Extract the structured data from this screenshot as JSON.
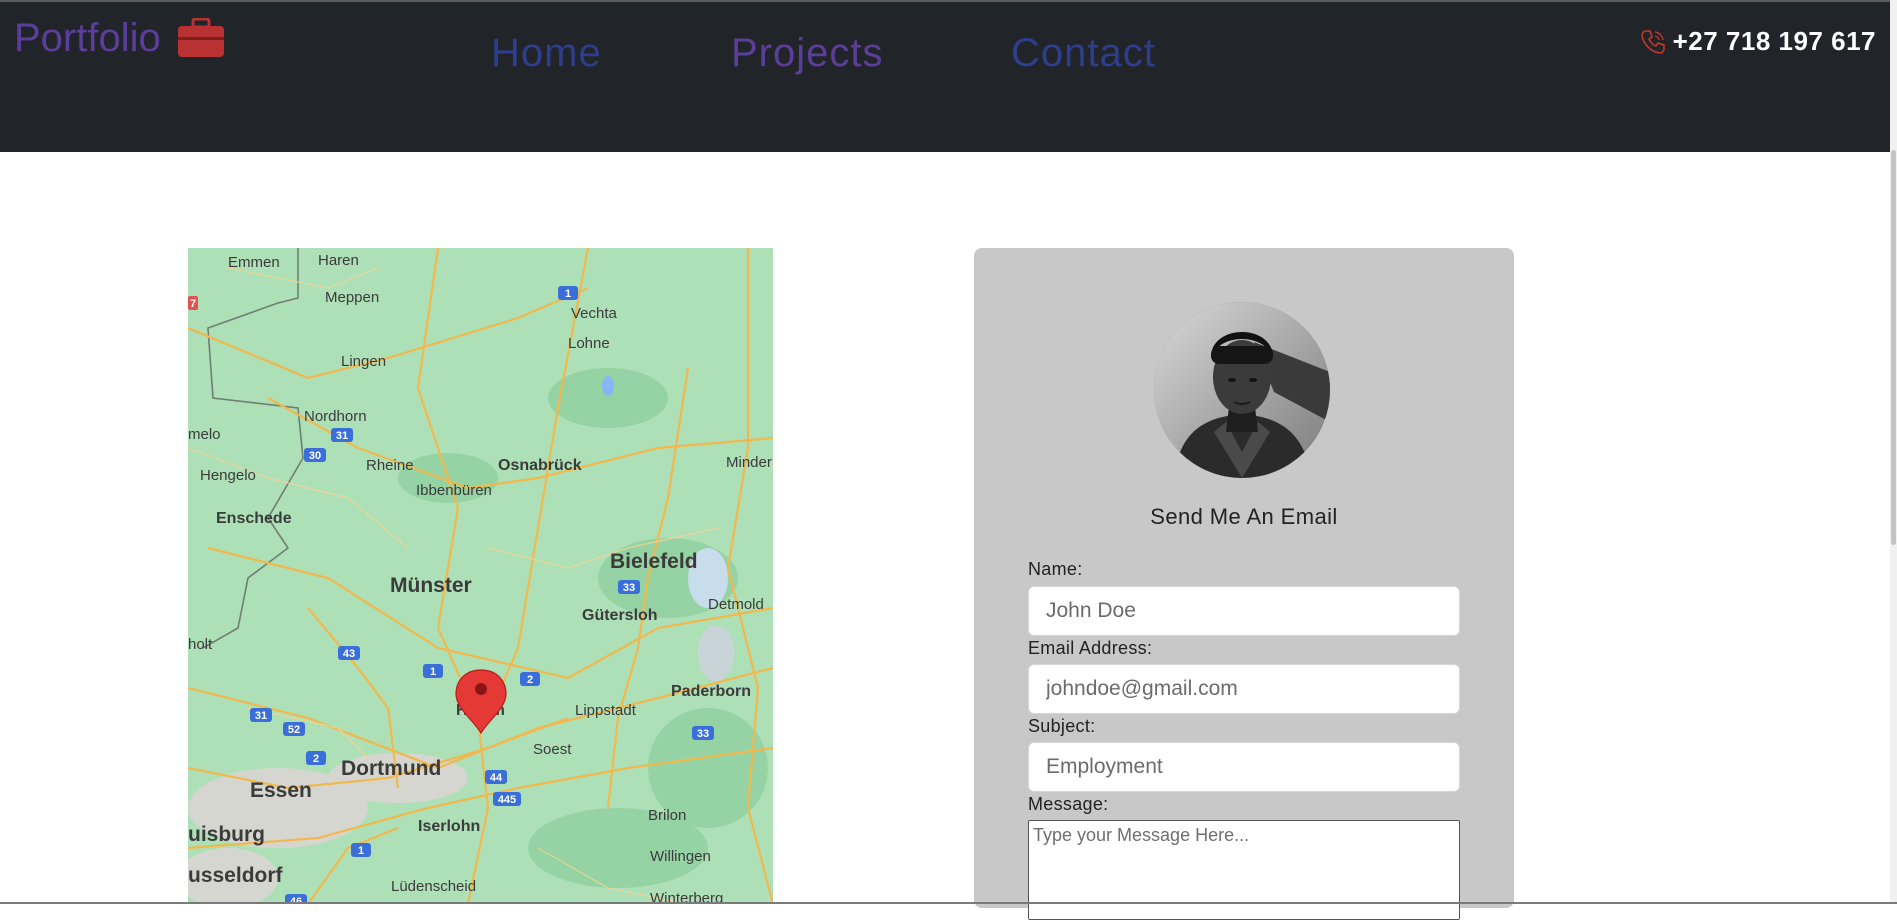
{
  "header": {
    "brand": "Portfolio",
    "brand_icon": "briefcase-icon",
    "nav": [
      {
        "label": "Home",
        "color": "#2e3d8c"
      },
      {
        "label": "Projects",
        "color": "#5b3e99"
      },
      {
        "label": "Contact",
        "color": "#2e3d8c"
      }
    ],
    "phone_icon": "phone-icon",
    "phone": "+27 718 197 617",
    "background": "#212429"
  },
  "map": {
    "marker_icon": "map-pin-icon",
    "places": [
      "Emmen",
      "Haren",
      "Meppen",
      "Vechta",
      "Lohne",
      "Lingen",
      "Nordhorn",
      "melo",
      "Rheine",
      "Osnabrück",
      "Minder",
      "Hengelo",
      "Ibbenbüren",
      "Enschede",
      "Bielefeld",
      "Münster",
      "Detmold",
      "Gütersloh",
      "holt",
      "Hamm",
      "Lippstadt",
      "Paderborn",
      "Soest",
      "Dortmund",
      "Essen",
      "Brilon",
      "Iserlohn",
      "uisburg",
      "Willingen",
      "usseldorf",
      "Lüdenscheid",
      "Winterberg"
    ],
    "roads": [
      "1",
      "31",
      "30",
      "33",
      "43",
      "1",
      "2",
      "31",
      "52",
      "2",
      "44",
      "445",
      "33",
      "1",
      "46",
      "7"
    ]
  },
  "contact_card": {
    "title": "Send Me An Email",
    "fields": [
      {
        "label": "Name:",
        "placeholder": "John Doe"
      },
      {
        "label": "Email Address:",
        "placeholder": "johndoe@gmail.com"
      },
      {
        "label": "Subject:",
        "placeholder": "Employment"
      }
    ],
    "message": {
      "label": "Message:",
      "placeholder": "Type your Message Here..."
    },
    "background": "#c8c8c8"
  }
}
